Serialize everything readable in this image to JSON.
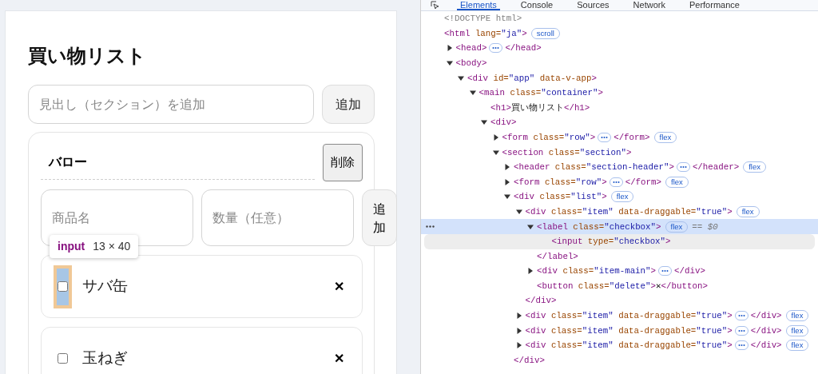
{
  "page": {
    "title": "買い物リスト",
    "section_form": {
      "placeholder": "見出し（セクション）を追加",
      "button": "追加"
    },
    "sections": [
      {
        "name": "バロー",
        "delete_button": "削除",
        "item_form": {
          "name_placeholder": "商品名",
          "quantity_placeholder": "数量（任意）",
          "button": "追加"
        },
        "items": [
          {
            "name": "サバ缶",
            "checked": false,
            "delete": "✕",
            "inspected": true
          },
          {
            "name": "玉ねぎ",
            "checked": false,
            "delete": "✕",
            "inspected": false
          }
        ]
      }
    ]
  },
  "inspector_tooltip": {
    "tag": "input",
    "size": "13 × 40"
  },
  "devtools": {
    "tabs": [
      {
        "label": "Elements",
        "selected": true
      },
      {
        "label": "Console",
        "selected": false
      },
      {
        "label": "Sources",
        "selected": false
      },
      {
        "label": "Network",
        "selected": false
      },
      {
        "label": "Performance",
        "selected": false
      }
    ],
    "tree": [
      {
        "open": [
          {
            "kind": "doctype",
            "text": "<!DOCTYPE html>"
          }
        ],
        "selected": false,
        "hovered": false
      },
      {
        "open": [
          {
            "kind": "tag",
            "text": "<html"
          },
          {
            "kind": "attr",
            "text": " lang="
          },
          {
            "kind": "value",
            "text": "\"ja\""
          },
          {
            "kind": "tag",
            "text": ">"
          }
        ],
        "badge": "scroll",
        "selected": false,
        "hovered": false,
        "children": [
          {
            "open": [
              {
                "kind": "tag",
                "text": "<head>"
              }
            ],
            "expanded": false,
            "ellipsis": true,
            "close_inline": [
              {
                "kind": "tag",
                "text": "</head>"
              }
            ],
            "selected": false,
            "hovered": false
          },
          {
            "open": [
              {
                "kind": "tag",
                "text": "<body>"
              }
            ],
            "expanded": true,
            "selected": false,
            "hovered": false,
            "children": [
              {
                "open": [
                  {
                    "kind": "tag",
                    "text": "<div"
                  },
                  {
                    "kind": "attr",
                    "text": " id="
                  },
                  {
                    "kind": "value",
                    "text": "\"app\""
                  },
                  {
                    "kind": "attr",
                    "text": " data-v-app"
                  },
                  {
                    "kind": "tag",
                    "text": ">"
                  }
                ],
                "expanded": true,
                "selected": false,
                "hovered": false,
                "children": [
                  {
                    "open": [
                      {
                        "kind": "tag",
                        "text": "<main"
                      },
                      {
                        "kind": "attr",
                        "text": " class="
                      },
                      {
                        "kind": "value",
                        "text": "\"container\""
                      },
                      {
                        "kind": "tag",
                        "text": ">"
                      }
                    ],
                    "expanded": true,
                    "selected": false,
                    "hovered": false,
                    "children": [
                      {
                        "open": [
                          {
                            "kind": "tag",
                            "text": "<h1>"
                          },
                          {
                            "kind": "text",
                            "text": "買い物リスト"
                          },
                          {
                            "kind": "tag",
                            "text": "</h1>"
                          }
                        ],
                        "selected": false,
                        "hovered": false
                      },
                      {
                        "open": [
                          {
                            "kind": "tag",
                            "text": "<div>"
                          }
                        ],
                        "expanded": true,
                        "selected": false,
                        "hovered": false,
                        "children": [
                          {
                            "open": [
                              {
                                "kind": "tag",
                                "text": "<form"
                              },
                              {
                                "kind": "attr",
                                "text": " class="
                              },
                              {
                                "kind": "value",
                                "text": "\"row\""
                              },
                              {
                                "kind": "tag",
                                "text": ">"
                              }
                            ],
                            "expanded": false,
                            "ellipsis": true,
                            "close_inline": [
                              {
                                "kind": "tag",
                                "text": "</form>"
                              }
                            ],
                            "badge": "flex",
                            "selected": false,
                            "hovered": false
                          },
                          {
                            "open": [
                              {
                                "kind": "tag",
                                "text": "<section"
                              },
                              {
                                "kind": "attr",
                                "text": " class="
                              },
                              {
                                "kind": "value",
                                "text": "\"section\""
                              },
                              {
                                "kind": "tag",
                                "text": ">"
                              }
                            ],
                            "expanded": true,
                            "selected": false,
                            "hovered": false,
                            "children": [
                              {
                                "open": [
                                  {
                                    "kind": "tag",
                                    "text": "<header"
                                  },
                                  {
                                    "kind": "attr",
                                    "text": " class="
                                  },
                                  {
                                    "kind": "value",
                                    "text": "\"section-header\""
                                  },
                                  {
                                    "kind": "tag",
                                    "text": ">"
                                  }
                                ],
                                "expanded": false,
                                "ellipsis": true,
                                "close_inline": [
                                  {
                                    "kind": "tag",
                                    "text": "</header>"
                                  }
                                ],
                                "badge": "flex",
                                "selected": false,
                                "hovered": false
                              },
                              {
                                "open": [
                                  {
                                    "kind": "tag",
                                    "text": "<form"
                                  },
                                  {
                                    "kind": "attr",
                                    "text": " class="
                                  },
                                  {
                                    "kind": "value",
                                    "text": "\"row\""
                                  },
                                  {
                                    "kind": "tag",
                                    "text": ">"
                                  }
                                ],
                                "expanded": false,
                                "ellipsis": true,
                                "close_inline": [
                                  {
                                    "kind": "tag",
                                    "text": "</form>"
                                  }
                                ],
                                "badge": "flex",
                                "selected": false,
                                "hovered": false
                              },
                              {
                                "open": [
                                  {
                                    "kind": "tag",
                                    "text": "<div"
                                  },
                                  {
                                    "kind": "attr",
                                    "text": " class="
                                  },
                                  {
                                    "kind": "value",
                                    "text": "\"list\""
                                  },
                                  {
                                    "kind": "tag",
                                    "text": ">"
                                  }
                                ],
                                "expanded": true,
                                "badge": "flex",
                                "selected": false,
                                "hovered": false,
                                "close": [
                                  {
                                    "kind": "tag",
                                    "text": "</div>"
                                  }
                                ],
                                "children": [
                                  {
                                    "open": [
                                      {
                                        "kind": "tag",
                                        "text": "<div"
                                      },
                                      {
                                        "kind": "attr",
                                        "text": " class="
                                      },
                                      {
                                        "kind": "value",
                                        "text": "\"item\""
                                      },
                                      {
                                        "kind": "attr",
                                        "text": " data-draggable="
                                      },
                                      {
                                        "kind": "value",
                                        "text": "\"true\""
                                      },
                                      {
                                        "kind": "tag",
                                        "text": ">"
                                      }
                                    ],
                                    "expanded": true,
                                    "badge": "flex",
                                    "selected": false,
                                    "hovered": false,
                                    "close": [
                                      {
                                        "kind": "tag",
                                        "text": "</div>"
                                      }
                                    ],
                                    "children": [
                                      {
                                        "open": [
                                          {
                                            "kind": "tag",
                                            "text": "<label"
                                          },
                                          {
                                            "kind": "attr",
                                            "text": " class="
                                          },
                                          {
                                            "kind": "value",
                                            "text": "\"checkbox\""
                                          },
                                          {
                                            "kind": "tag",
                                            "text": ">"
                                          }
                                        ],
                                        "expanded": true,
                                        "badge": "flex",
                                        "note": "== $0",
                                        "selected": true,
                                        "hovered": false,
                                        "close": [
                                          {
                                            "kind": "tag",
                                            "text": "</label>"
                                          }
                                        ],
                                        "children": [
                                          {
                                            "open": [
                                              {
                                                "kind": "tag",
                                                "text": "<input"
                                              },
                                              {
                                                "kind": "attr",
                                                "text": " type="
                                              },
                                              {
                                                "kind": "value",
                                                "text": "\"checkbox\""
                                              },
                                              {
                                                "kind": "tag",
                                                "text": ">"
                                              }
                                            ],
                                            "selected": false,
                                            "hovered": true
                                          }
                                        ]
                                      },
                                      {
                                        "open": [
                                          {
                                            "kind": "tag",
                                            "text": "<div"
                                          },
                                          {
                                            "kind": "attr",
                                            "text": " class="
                                          },
                                          {
                                            "kind": "value",
                                            "text": "\"item-main\""
                                          },
                                          {
                                            "kind": "tag",
                                            "text": ">"
                                          }
                                        ],
                                        "expanded": false,
                                        "ellipsis": true,
                                        "close_inline": [
                                          {
                                            "kind": "tag",
                                            "text": "</div>"
                                          }
                                        ],
                                        "selected": false,
                                        "hovered": false
                                      },
                                      {
                                        "open": [
                                          {
                                            "kind": "tag",
                                            "text": "<button"
                                          },
                                          {
                                            "kind": "attr",
                                            "text": " class="
                                          },
                                          {
                                            "kind": "value",
                                            "text": "\"delete\""
                                          },
                                          {
                                            "kind": "tag",
                                            "text": ">"
                                          },
                                          {
                                            "kind": "text",
                                            "text": "✕"
                                          },
                                          {
                                            "kind": "tag",
                                            "text": "</button>"
                                          }
                                        ],
                                        "selected": false,
                                        "hovered": false
                                      }
                                    ]
                                  },
                                  {
                                    "open": [
                                      {
                                        "kind": "tag",
                                        "text": "<div"
                                      },
                                      {
                                        "kind": "attr",
                                        "text": " class="
                                      },
                                      {
                                        "kind": "value",
                                        "text": "\"item\""
                                      },
                                      {
                                        "kind": "attr",
                                        "text": " data-draggable="
                                      },
                                      {
                                        "kind": "value",
                                        "text": "\"true\""
                                      },
                                      {
                                        "kind": "tag",
                                        "text": ">"
                                      }
                                    ],
                                    "expanded": false,
                                    "ellipsis": true,
                                    "close_inline": [
                                      {
                                        "kind": "tag",
                                        "text": "</div>"
                                      }
                                    ],
                                    "badge": "flex",
                                    "selected": false,
                                    "hovered": false
                                  },
                                  {
                                    "open": [
                                      {
                                        "kind": "tag",
                                        "text": "<div"
                                      },
                                      {
                                        "kind": "attr",
                                        "text": " class="
                                      },
                                      {
                                        "kind": "value",
                                        "text": "\"item\""
                                      },
                                      {
                                        "kind": "attr",
                                        "text": " data-draggable="
                                      },
                                      {
                                        "kind": "value",
                                        "text": "\"true\""
                                      },
                                      {
                                        "kind": "tag",
                                        "text": ">"
                                      }
                                    ],
                                    "expanded": false,
                                    "ellipsis": true,
                                    "close_inline": [
                                      {
                                        "kind": "tag",
                                        "text": "</div>"
                                      }
                                    ],
                                    "badge": "flex",
                                    "selected": false,
                                    "hovered": false
                                  },
                                  {
                                    "open": [
                                      {
                                        "kind": "tag",
                                        "text": "<div"
                                      },
                                      {
                                        "kind": "attr",
                                        "text": " class="
                                      },
                                      {
                                        "kind": "value",
                                        "text": "\"item\""
                                      },
                                      {
                                        "kind": "attr",
                                        "text": " data-draggable="
                                      },
                                      {
                                        "kind": "value",
                                        "text": "\"true\""
                                      },
                                      {
                                        "kind": "tag",
                                        "text": ">"
                                      }
                                    ],
                                    "expanded": false,
                                    "ellipsis": true,
                                    "close_inline": [
                                      {
                                        "kind": "tag",
                                        "text": "</div>"
                                      }
                                    ],
                                    "badge": "flex",
                                    "selected": false,
                                    "hovered": false
                                  }
                                ]
                              }
                            ]
                          }
                        ]
                      }
                    ]
                  }
                ]
              }
            ]
          }
        ]
      }
    ]
  }
}
